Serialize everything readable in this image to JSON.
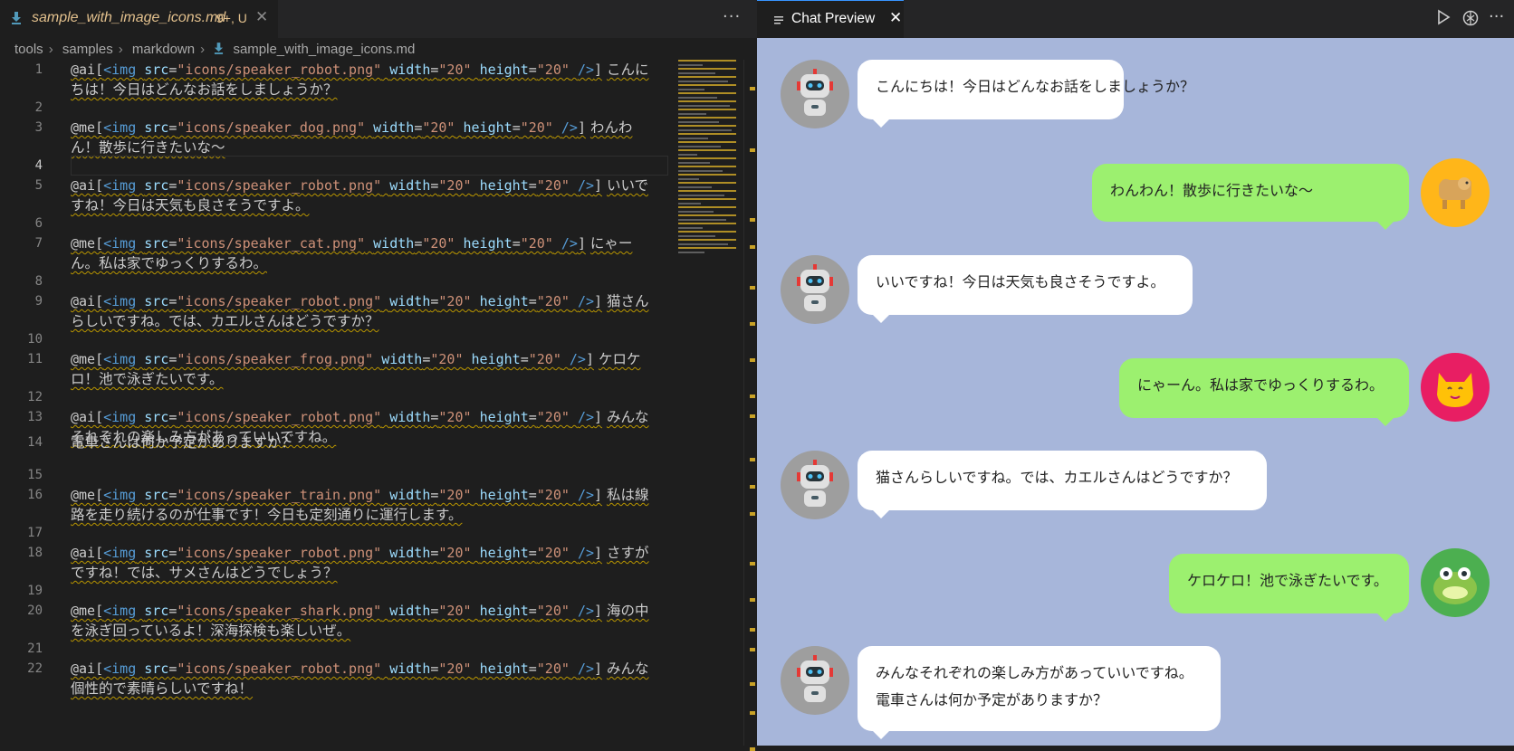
{
  "editor": {
    "tab": {
      "file_name": "sample_with_image_icons.md",
      "badge": "9+, U",
      "close": "✕"
    },
    "more": "···",
    "breadcrumb": [
      "tools",
      "samples",
      "markdown",
      "sample_with_image_icons.md"
    ],
    "lines": [
      {
        "n": "1",
        "type": "code",
        "who": "@ai[",
        "src": "\"icons/speaker_robot.png\"",
        "w": "\"20\"",
        "h": "\"20\"",
        "msg": "こんにちは！今日はどんなお話をしましょうか？"
      },
      {
        "n": "2",
        "type": "blank"
      },
      {
        "n": "3",
        "type": "code",
        "who": "@me[",
        "src": "\"icons/speaker_dog.png\"",
        "w": "\"20\"",
        "h": "\"20\"",
        "msg": "わんわん！散歩に行きたいな～"
      },
      {
        "n": "4",
        "type": "blank",
        "active": true
      },
      {
        "n": "5",
        "type": "code",
        "who": "@ai[",
        "src": "\"icons/speaker_robot.png\"",
        "w": "\"20\"",
        "h": "\"20\"",
        "msg": "いいですね！今日は天気も良さそうですよ。"
      },
      {
        "n": "6",
        "type": "blank"
      },
      {
        "n": "7",
        "type": "code",
        "who": "@me[",
        "src": "\"icons/speaker_cat.png\"",
        "w": "\"20\"",
        "h": "\"20\"",
        "msg": "にゃーん。私は家でゆっくりするわ。"
      },
      {
        "n": "8",
        "type": "blank"
      },
      {
        "n": "9",
        "type": "code",
        "who": "@ai[",
        "src": "\"icons/speaker_robot.png\"",
        "w": "\"20\"",
        "h": "\"20\"",
        "msg": "猫さんらしいですね。では、カエルさんはどうですか？"
      },
      {
        "n": "10",
        "type": "blank"
      },
      {
        "n": "11",
        "type": "code",
        "who": "@me[",
        "src": "\"icons/speaker_frog.png\"",
        "w": "\"20\"",
        "h": "\"20\"",
        "msg": "ケロケロ！池で泳ぎたいです。"
      },
      {
        "n": "12",
        "type": "blank"
      },
      {
        "n": "13",
        "type": "code",
        "who": "@ai[",
        "src": "\"icons/speaker_robot.png\"",
        "w": "\"20\"",
        "h": "\"20\"",
        "msg": "みんなそれぞれの楽しみ方があっていいですね。"
      },
      {
        "n": "14",
        "type": "text",
        "msg": "電車さんは何か予定がありますか？"
      },
      {
        "n": "15",
        "type": "blank"
      },
      {
        "n": "16",
        "type": "code",
        "who": "@me[",
        "src": "\"icons/speaker_train.png\"",
        "w": "\"20\"",
        "h": "\"20\"",
        "msg": "私は線路を走り続けるのが仕事です！今日も定刻通りに運行します。"
      },
      {
        "n": "17",
        "type": "blank"
      },
      {
        "n": "18",
        "type": "code",
        "who": "@ai[",
        "src": "\"icons/speaker_robot.png\"",
        "w": "\"20\"",
        "h": "\"20\"",
        "msg": "さすがですね！では、サメさんはどうでしょう？"
      },
      {
        "n": "19",
        "type": "blank"
      },
      {
        "n": "20",
        "type": "code",
        "who": "@me[",
        "src": "\"icons/speaker_shark.png\"",
        "w": "\"20\"",
        "h": "\"20\"",
        "msg": "海の中を泳ぎ回っているよ！深海探検も楽しいぜ。"
      },
      {
        "n": "21",
        "type": "blank"
      },
      {
        "n": "22",
        "type": "code",
        "who": "@ai[",
        "src": "\"icons/speaker_robot.png\"",
        "w": "\"20\"",
        "h": "\"20\"",
        "msg": "みんな個性的で素晴らしいですね！"
      }
    ],
    "syntax": {
      "tag": "<img",
      "src_attr": "src",
      "width_attr": "width",
      "height_attr": "height",
      "eq": "=",
      "close": "/>",
      "end": "]"
    }
  },
  "preview": {
    "tab": {
      "title": "Chat Preview",
      "close": "✕"
    },
    "actions": [
      "play-icon",
      "openai-icon",
      "more-icon"
    ],
    "more": "···",
    "messages": [
      {
        "side": "ai",
        "speaker": "robot",
        "text": [
          "こんにちは！今日はどんなお話をしましょうか？"
        ]
      },
      {
        "side": "me",
        "speaker": "dog",
        "text": [
          "わんわん！散歩に行きたいな～"
        ]
      },
      {
        "side": "ai",
        "speaker": "robot",
        "text": [
          "いいですね！今日は天気も良さそうですよ。"
        ]
      },
      {
        "side": "me",
        "speaker": "cat",
        "text": [
          "にゃーん。私は家でゆっくりするわ。"
        ]
      },
      {
        "side": "ai",
        "speaker": "robot",
        "text": [
          "猫さんらしいですね。では、カエルさんはどうですか？"
        ]
      },
      {
        "side": "me",
        "speaker": "frog",
        "text": [
          "ケロケロ！池で泳ぎたいです。"
        ]
      },
      {
        "side": "ai",
        "speaker": "robot",
        "text": [
          "みんなそれぞれの楽しみ方があっていいですね。",
          "電車さんは何か予定がありますか？"
        ]
      }
    ]
  },
  "colors": {
    "ai_bubble": "#ffffff",
    "me_bubble": "#9cf06f",
    "chat_bg": "#a7b6da",
    "dog_bg": "#ffb619",
    "cat_bg": "#e81e63",
    "frog_bg": "#4caf50",
    "robot_bg": "#9e9e9e"
  }
}
